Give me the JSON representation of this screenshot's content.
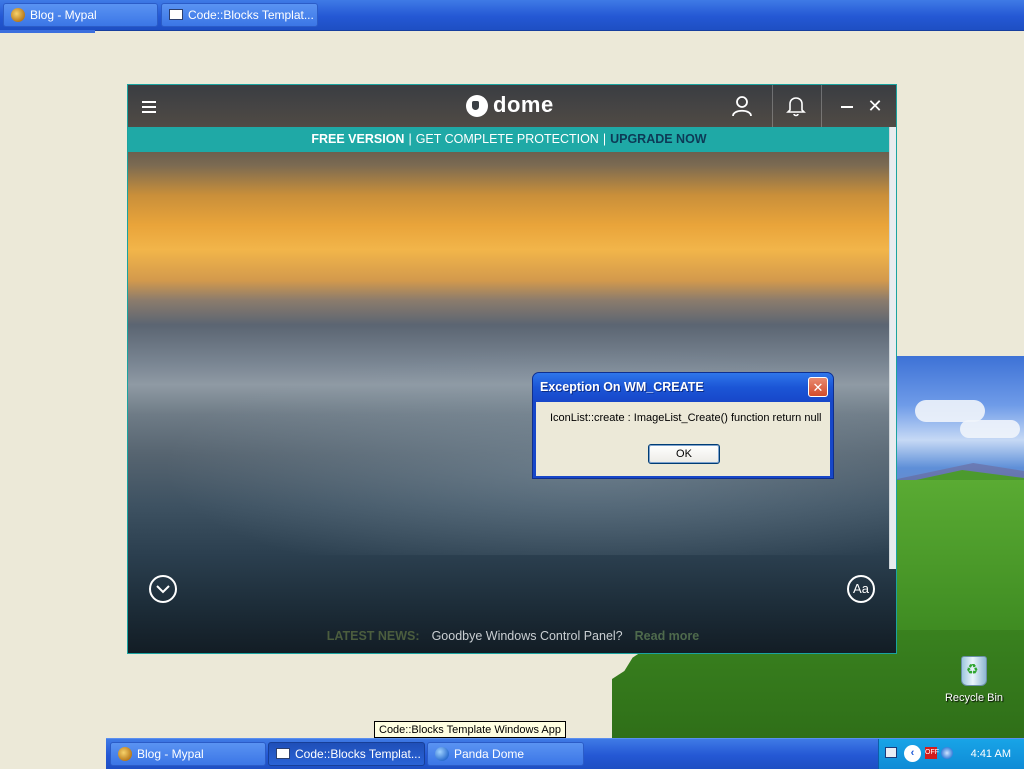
{
  "top_taskbar": {
    "buttons": [
      {
        "label": "Blog - Mypal",
        "icon": "mypal-icon"
      },
      {
        "label": "Code::Blocks Templat...",
        "icon": "window-icon"
      }
    ]
  },
  "desktop": {
    "recycle_bin_label": "Recycle Bin"
  },
  "panda": {
    "logo_text": "dome",
    "banner": {
      "free": "FREE VERSION",
      "get": "GET COMPLETE PROTECTION",
      "upgrade": "UPGRADE NOW",
      "separator": "|"
    },
    "font_button_label": "Aa",
    "news": {
      "label": "LATEST NEWS:",
      "headline": "Goodbye Windows Control Panel?",
      "link": "Read more"
    },
    "colors": {
      "accent": "#1fa9a6"
    }
  },
  "dialog": {
    "title": "Exception On WM_CREATE",
    "message": "IconList::create : ImageList_Create() function return null",
    "ok_label": "OK",
    "close_glyph": "✕"
  },
  "tooltip": "Code::Blocks Template Windows App",
  "bottom_taskbar": {
    "buttons": [
      {
        "label": "Blog - Mypal",
        "icon": "mypal-icon"
      },
      {
        "label": "Code::Blocks Templat...",
        "icon": "window-icon"
      },
      {
        "label": "Panda Dome",
        "icon": "panda-icon"
      }
    ],
    "tray": {
      "off_badge": "OFF",
      "clock": "4:41 AM"
    }
  }
}
